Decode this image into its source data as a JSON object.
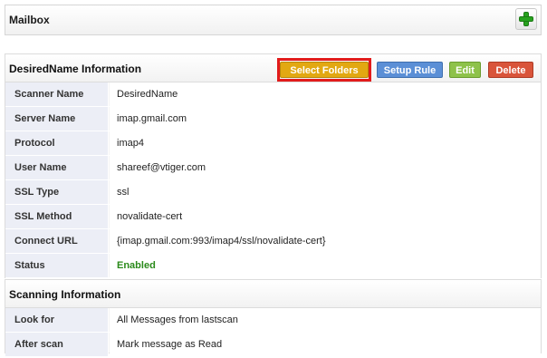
{
  "mailbox": {
    "title": "Mailbox",
    "add_icon": "plus-icon"
  },
  "info": {
    "title": "DesiredName Information",
    "buttons": {
      "select_folders": "Select Folders",
      "setup_rule": "Setup Rule",
      "edit": "Edit",
      "delete": "Delete"
    },
    "rows": [
      {
        "label": "Scanner Name",
        "value": "DesiredName"
      },
      {
        "label": "Server Name",
        "value": "imap.gmail.com"
      },
      {
        "label": "Protocol",
        "value": "imap4"
      },
      {
        "label": "User Name",
        "value": "shareef@vtiger.com"
      },
      {
        "label": "SSL Type",
        "value": "ssl"
      },
      {
        "label": "SSL Method",
        "value": "novalidate-cert"
      },
      {
        "label": "Connect URL",
        "value": "{imap.gmail.com:993/imap4/ssl/novalidate-cert}"
      },
      {
        "label": "Status",
        "value": "Enabled"
      }
    ]
  },
  "scanning": {
    "title": "Scanning Information",
    "rows": [
      {
        "label": "Look for",
        "value": "All Messages from lastscan"
      },
      {
        "label": "After scan",
        "value": "Mark message as Read"
      }
    ]
  },
  "colors": {
    "select_folders": "#e2a812",
    "setup_rule": "#5b8fd6",
    "edit": "#8ec24a",
    "delete": "#d9543a",
    "status_enabled": "#2a8a1a",
    "highlight": "#e21b1b"
  }
}
